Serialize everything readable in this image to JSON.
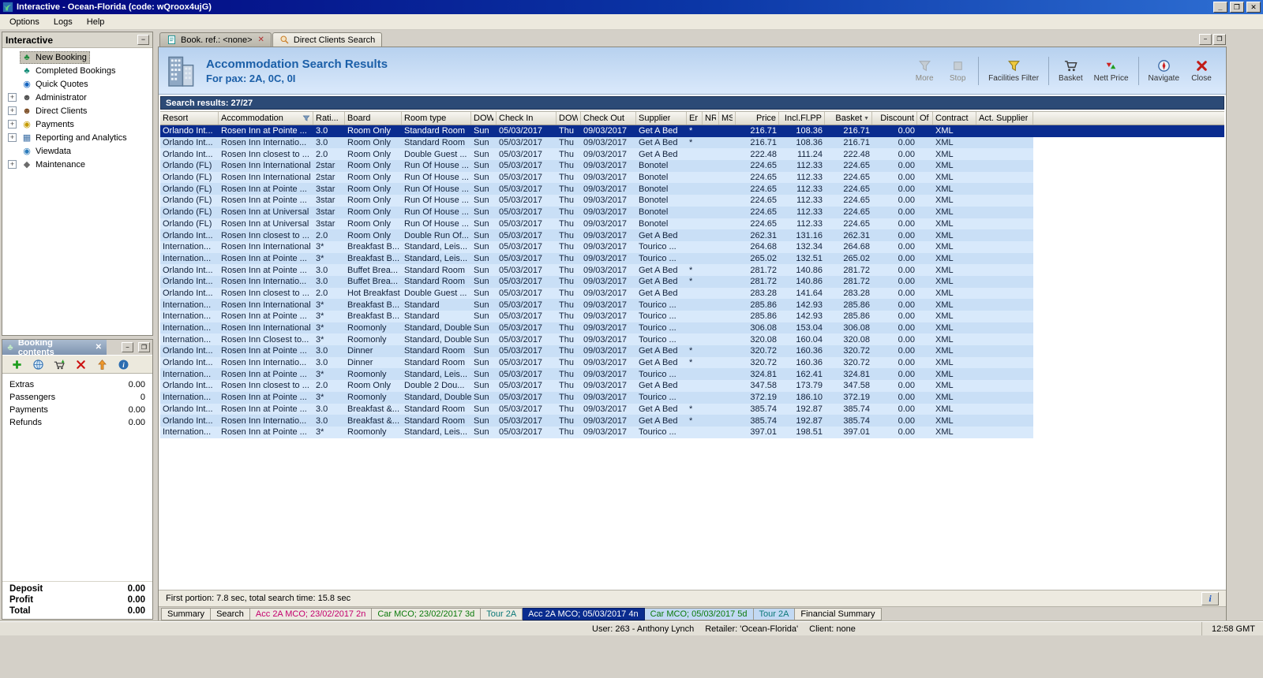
{
  "window": {
    "title": "Interactive - Ocean-Florida (code: wQroox4ujG)"
  },
  "menu": [
    "Options",
    "Logs",
    "Help"
  ],
  "sidebar": {
    "title": "Interactive",
    "items": [
      {
        "label": "New Booking",
        "icon": "palm-icon",
        "expandable": false,
        "selected": true
      },
      {
        "label": "Completed Bookings",
        "icon": "completed-bookings-icon",
        "expandable": false
      },
      {
        "label": "Quick Quotes",
        "icon": "quick-quotes-icon",
        "expandable": false
      },
      {
        "label": "Administrator",
        "icon": "administrator-icon",
        "expandable": true
      },
      {
        "label": "Direct Clients",
        "icon": "clients-icon",
        "expandable": true
      },
      {
        "label": "Payments",
        "icon": "payments-icon",
        "expandable": true
      },
      {
        "label": "Reporting and Analytics",
        "icon": "chart-icon",
        "expandable": true
      },
      {
        "label": "Viewdata",
        "icon": "viewdata-icon",
        "expandable": false
      },
      {
        "label": "Maintenance",
        "icon": "maintenance-icon",
        "expandable": true
      }
    ]
  },
  "booking_contents": {
    "title": "Booking contents",
    "toolbar": [
      "add-icon",
      "world-icon",
      "basket-add-icon",
      "delete-icon",
      "move-up-icon",
      "info-circle-icon"
    ],
    "rows": [
      {
        "label": "Extras",
        "value": "0.00"
      },
      {
        "label": "Passengers",
        "value": "0"
      },
      {
        "label": "Payments",
        "value": "0.00"
      },
      {
        "label": "Refunds",
        "value": "0.00"
      }
    ],
    "totals": [
      {
        "label": "Deposit",
        "value": "0.00"
      },
      {
        "label": "Profit",
        "value": "0.00"
      },
      {
        "label": "Total",
        "value": "0.00"
      }
    ]
  },
  "tabs": [
    {
      "label": "Book. ref.: <none>",
      "active": true
    },
    {
      "label": "Direct Clients Search",
      "active": false
    }
  ],
  "header": {
    "title": "Accommodation Search Results",
    "subtitle": "For pax: 2A, 0C, 0I",
    "buttons": [
      {
        "label": "More",
        "icon": "funnel-gray-icon",
        "disabled": true
      },
      {
        "label": "Stop",
        "icon": "stop-icon",
        "disabled": true
      },
      {
        "label": "Facilities Filter",
        "icon": "funnel-icon",
        "disabled": false
      },
      {
        "label": "Basket",
        "icon": "basket-icon",
        "disabled": false
      },
      {
        "label": "Nett Price",
        "icon": "nett-price-icon",
        "disabled": false
      },
      {
        "label": "Navigate",
        "icon": "navigate-icon",
        "disabled": false
      },
      {
        "label": "Close",
        "icon": "close-red-icon",
        "disabled": false
      }
    ],
    "separators_after": [
      1,
      2,
      4
    ]
  },
  "results_bar": "Search results: 27/27",
  "table": {
    "columns": [
      "Resort",
      "Accommodation",
      "Rati...",
      "Board",
      "Room type",
      "DOW",
      "Check In",
      "DOW",
      "Check Out",
      "Supplier",
      "Er",
      "NR",
      "MS",
      "Price",
      "Incl.Fl.PP",
      "Basket",
      "Discount",
      "Of",
      "Contract",
      "Act. Supplier"
    ],
    "selected_row": 0,
    "rows": [
      [
        "Orlando Int...",
        "Rosen Inn at Pointe ...",
        "3.0",
        "Room Only",
        "Standard Room",
        "Sun",
        "05/03/2017",
        "Thu",
        "09/03/2017",
        "Get A Bed",
        "*",
        "",
        "",
        "216.71",
        "108.36",
        "216.71",
        "0.00",
        "",
        "XML",
        ""
      ],
      [
        "Orlando Int...",
        "Rosen Inn Internatio...",
        "3.0",
        "Room Only",
        "Standard Room",
        "Sun",
        "05/03/2017",
        "Thu",
        "09/03/2017",
        "Get A Bed",
        "*",
        "",
        "",
        "216.71",
        "108.36",
        "216.71",
        "0.00",
        "",
        "XML",
        ""
      ],
      [
        "Orlando Int...",
        "Rosen Inn closest to ...",
        "2.0",
        "Room Only",
        "Double Guest ...",
        "Sun",
        "05/03/2017",
        "Thu",
        "09/03/2017",
        "Get A Bed",
        "",
        "",
        "",
        "222.48",
        "111.24",
        "222.48",
        "0.00",
        "",
        "XML",
        ""
      ],
      [
        "Orlando (FL)",
        "Rosen Inn International",
        "2star",
        "Room Only",
        "Run Of House ...",
        "Sun",
        "05/03/2017",
        "Thu",
        "09/03/2017",
        "Bonotel",
        "",
        "",
        "",
        "224.65",
        "112.33",
        "224.65",
        "0.00",
        "",
        "XML",
        ""
      ],
      [
        "Orlando (FL)",
        "Rosen Inn International",
        "2star",
        "Room Only",
        "Run Of House ...",
        "Sun",
        "05/03/2017",
        "Thu",
        "09/03/2017",
        "Bonotel",
        "",
        "",
        "",
        "224.65",
        "112.33",
        "224.65",
        "0.00",
        "",
        "XML",
        ""
      ],
      [
        "Orlando (FL)",
        "Rosen Inn at Pointe ...",
        "3star",
        "Room Only",
        "Run Of House ...",
        "Sun",
        "05/03/2017",
        "Thu",
        "09/03/2017",
        "Bonotel",
        "",
        "",
        "",
        "224.65",
        "112.33",
        "224.65",
        "0.00",
        "",
        "XML",
        ""
      ],
      [
        "Orlando (FL)",
        "Rosen Inn at Pointe ...",
        "3star",
        "Room Only",
        "Run Of House ...",
        "Sun",
        "05/03/2017",
        "Thu",
        "09/03/2017",
        "Bonotel",
        "",
        "",
        "",
        "224.65",
        "112.33",
        "224.65",
        "0.00",
        "",
        "XML",
        ""
      ],
      [
        "Orlando (FL)",
        "Rosen Inn at Universal",
        "3star",
        "Room Only",
        "Run Of House ...",
        "Sun",
        "05/03/2017",
        "Thu",
        "09/03/2017",
        "Bonotel",
        "",
        "",
        "",
        "224.65",
        "112.33",
        "224.65",
        "0.00",
        "",
        "XML",
        ""
      ],
      [
        "Orlando (FL)",
        "Rosen Inn at Universal",
        "3star",
        "Room Only",
        "Run Of House ...",
        "Sun",
        "05/03/2017",
        "Thu",
        "09/03/2017",
        "Bonotel",
        "",
        "",
        "",
        "224.65",
        "112.33",
        "224.65",
        "0.00",
        "",
        "XML",
        ""
      ],
      [
        "Orlando Int...",
        "Rosen Inn closest to ...",
        "2.0",
        "Room Only",
        "Double Run Of...",
        "Sun",
        "05/03/2017",
        "Thu",
        "09/03/2017",
        "Get A Bed",
        "",
        "",
        "",
        "262.31",
        "131.16",
        "262.31",
        "0.00",
        "",
        "XML",
        ""
      ],
      [
        "Internation...",
        "Rosen Inn International",
        "3*",
        "Breakfast B...",
        "Standard, Leis...",
        "Sun",
        "05/03/2017",
        "Thu",
        "09/03/2017",
        "Tourico ...",
        "",
        "",
        "",
        "264.68",
        "132.34",
        "264.68",
        "0.00",
        "",
        "XML",
        ""
      ],
      [
        "Internation...",
        "Rosen Inn at Pointe ...",
        "3*",
        "Breakfast B...",
        "Standard, Leis...",
        "Sun",
        "05/03/2017",
        "Thu",
        "09/03/2017",
        "Tourico ...",
        "",
        "",
        "",
        "265.02",
        "132.51",
        "265.02",
        "0.00",
        "",
        "XML",
        ""
      ],
      [
        "Orlando Int...",
        "Rosen Inn at Pointe ...",
        "3.0",
        "Buffet Brea...",
        "Standard Room",
        "Sun",
        "05/03/2017",
        "Thu",
        "09/03/2017",
        "Get A Bed",
        "*",
        "",
        "",
        "281.72",
        "140.86",
        "281.72",
        "0.00",
        "",
        "XML",
        ""
      ],
      [
        "Orlando Int...",
        "Rosen Inn Internatio...",
        "3.0",
        "Buffet Brea...",
        "Standard Room",
        "Sun",
        "05/03/2017",
        "Thu",
        "09/03/2017",
        "Get A Bed",
        "*",
        "",
        "",
        "281.72",
        "140.86",
        "281.72",
        "0.00",
        "",
        "XML",
        ""
      ],
      [
        "Orlando Int...",
        "Rosen Inn closest to ...",
        "2.0",
        "Hot Breakfast",
        "Double Guest ...",
        "Sun",
        "05/03/2017",
        "Thu",
        "09/03/2017",
        "Get A Bed",
        "",
        "",
        "",
        "283.28",
        "141.64",
        "283.28",
        "0.00",
        "",
        "XML",
        ""
      ],
      [
        "Internation...",
        "Rosen Inn International",
        "3*",
        "Breakfast B...",
        "Standard",
        "Sun",
        "05/03/2017",
        "Thu",
        "09/03/2017",
        "Tourico ...",
        "",
        "",
        "",
        "285.86",
        "142.93",
        "285.86",
        "0.00",
        "",
        "XML",
        ""
      ],
      [
        "Internation...",
        "Rosen Inn at Pointe ...",
        "3*",
        "Breakfast B...",
        "Standard",
        "Sun",
        "05/03/2017",
        "Thu",
        "09/03/2017",
        "Tourico ...",
        "",
        "",
        "",
        "285.86",
        "142.93",
        "285.86",
        "0.00",
        "",
        "XML",
        ""
      ],
      [
        "Internation...",
        "Rosen Inn International",
        "3*",
        "Roomonly",
        "Standard, Double",
        "Sun",
        "05/03/2017",
        "Thu",
        "09/03/2017",
        "Tourico ...",
        "",
        "",
        "",
        "306.08",
        "153.04",
        "306.08",
        "0.00",
        "",
        "XML",
        ""
      ],
      [
        "Internation...",
        "Rosen Inn Closest to...",
        "3*",
        "Roomonly",
        "Standard, Double",
        "Sun",
        "05/03/2017",
        "Thu",
        "09/03/2017",
        "Tourico ...",
        "",
        "",
        "",
        "320.08",
        "160.04",
        "320.08",
        "0.00",
        "",
        "XML",
        ""
      ],
      [
        "Orlando Int...",
        "Rosen Inn at Pointe ...",
        "3.0",
        "Dinner",
        "Standard Room",
        "Sun",
        "05/03/2017",
        "Thu",
        "09/03/2017",
        "Get A Bed",
        "*",
        "",
        "",
        "320.72",
        "160.36",
        "320.72",
        "0.00",
        "",
        "XML",
        ""
      ],
      [
        "Orlando Int...",
        "Rosen Inn Internatio...",
        "3.0",
        "Dinner",
        "Standard Room",
        "Sun",
        "05/03/2017",
        "Thu",
        "09/03/2017",
        "Get A Bed",
        "*",
        "",
        "",
        "320.72",
        "160.36",
        "320.72",
        "0.00",
        "",
        "XML",
        ""
      ],
      [
        "Internation...",
        "Rosen Inn at Pointe ...",
        "3*",
        "Roomonly",
        "Standard, Leis...",
        "Sun",
        "05/03/2017",
        "Thu",
        "09/03/2017",
        "Tourico ...",
        "",
        "",
        "",
        "324.81",
        "162.41",
        "324.81",
        "0.00",
        "",
        "XML",
        ""
      ],
      [
        "Orlando Int...",
        "Rosen Inn closest to ...",
        "2.0",
        "Room Only",
        "Double 2 Dou...",
        "Sun",
        "05/03/2017",
        "Thu",
        "09/03/2017",
        "Get A Bed",
        "",
        "",
        "",
        "347.58",
        "173.79",
        "347.58",
        "0.00",
        "",
        "XML",
        ""
      ],
      [
        "Internation...",
        "Rosen Inn at Pointe ...",
        "3*",
        "Roomonly",
        "Standard, Double",
        "Sun",
        "05/03/2017",
        "Thu",
        "09/03/2017",
        "Tourico ...",
        "",
        "",
        "",
        "372.19",
        "186.10",
        "372.19",
        "0.00",
        "",
        "XML",
        ""
      ],
      [
        "Orlando Int...",
        "Rosen Inn at Pointe ...",
        "3.0",
        "Breakfast &...",
        "Standard Room",
        "Sun",
        "05/03/2017",
        "Thu",
        "09/03/2017",
        "Get A Bed",
        "*",
        "",
        "",
        "385.74",
        "192.87",
        "385.74",
        "0.00",
        "",
        "XML",
        ""
      ],
      [
        "Orlando Int...",
        "Rosen Inn Internatio...",
        "3.0",
        "Breakfast &...",
        "Standard Room",
        "Sun",
        "05/03/2017",
        "Thu",
        "09/03/2017",
        "Get A Bed",
        "*",
        "",
        "",
        "385.74",
        "192.87",
        "385.74",
        "0.00",
        "",
        "XML",
        ""
      ],
      [
        "Internation...",
        "Rosen Inn at Pointe ...",
        "3*",
        "Roomonly",
        "Standard, Leis...",
        "Sun",
        "05/03/2017",
        "Thu",
        "09/03/2017",
        "Tourico ...",
        "",
        "",
        "",
        "397.01",
        "198.51",
        "397.01",
        "0.00",
        "",
        "XML",
        ""
      ]
    ]
  },
  "status_line": "First portion: 7.8 sec, total search time: 15.8 sec",
  "bottom_tabs": [
    {
      "label": "Summary"
    },
    {
      "label": "Search"
    },
    {
      "label": "Acc 2A MCO; 23/02/2017 2n",
      "color": "pink"
    },
    {
      "label": "Car MCO; 23/02/2017 3d",
      "color": "green"
    },
    {
      "label": "Tour 2A",
      "color": "teal"
    },
    {
      "label": "Acc 2A MCO; 05/03/2017 4n",
      "selected": true
    },
    {
      "label": "Car MCO; 05/03/2017 5d",
      "color": "green",
      "highlight": true
    },
    {
      "label": "Tour 2A",
      "color": "teal",
      "highlight": true
    },
    {
      "label": "Financial Summary"
    }
  ],
  "status_bar": {
    "user": "User: 263 - Anthony Lynch",
    "retailer": "Retailer: 'Ocean-Florida'",
    "client": "Client: none",
    "time": "12:58 GMT"
  }
}
